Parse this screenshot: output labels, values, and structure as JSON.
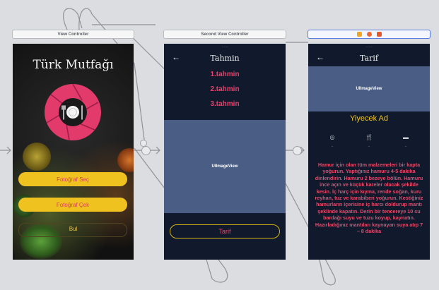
{
  "storyboard": {
    "scenes": [
      {
        "title": "View Controller"
      },
      {
        "title": "Second View Controller"
      },
      {
        "title": ""
      }
    ]
  },
  "screen1": {
    "title": "Türk Mutfağı",
    "logo_icon": "camera-shutter-plate-icon",
    "buttons": {
      "photo_select": "Fotoğraf Seç",
      "photo_take": "Fotoğraf Çek",
      "find": "Bul"
    }
  },
  "screen2": {
    "nav_title": "Tahmin",
    "guesses": [
      "1.tahmin",
      "2.tahmin",
      "3.tahmin"
    ],
    "image_placeholder": "UIImageView",
    "recipe_button": "Tarif"
  },
  "screen3": {
    "nav_title": "Tarif",
    "image_placeholder": "UIImageView",
    "food_name": "Yiyecek Ad",
    "meta": [
      {
        "icon": "clock-icon",
        "value": "-"
      },
      {
        "icon": "utensils-icon",
        "value": "-"
      },
      {
        "icon": "calendar-icon",
        "value": "-"
      }
    ],
    "recipe_text": "Hamur için olan tüm malzemeleri bir kapta yoğurun. Yaptığınız hamuru 4-5 dakika dinlendirin. Hamuru 2 bezeye bölün. Hamuru ince açın ve küçük kareler olacak şekilde kesin. İç harç için kıyma, rende soğan, kuru reyhan, tuz ve karabiberi yoğurun. Kestiğiniz hamurların içerisine iç harcı doldurup mantı şeklinde kapatın. Derin bir tencereye 10 su bardağı suyu ve tuzu koyup, kaynatın. Hazırladığınız mantıları kaynayan suya atıp 7 – 8 dakika"
  },
  "colors": {
    "canvas": "#dcdde0",
    "accent_yellow": "#f0c21f",
    "accent_pink": "#e24a6a",
    "dark_bg": "#101a2c",
    "image_view": "#4a5d84"
  }
}
